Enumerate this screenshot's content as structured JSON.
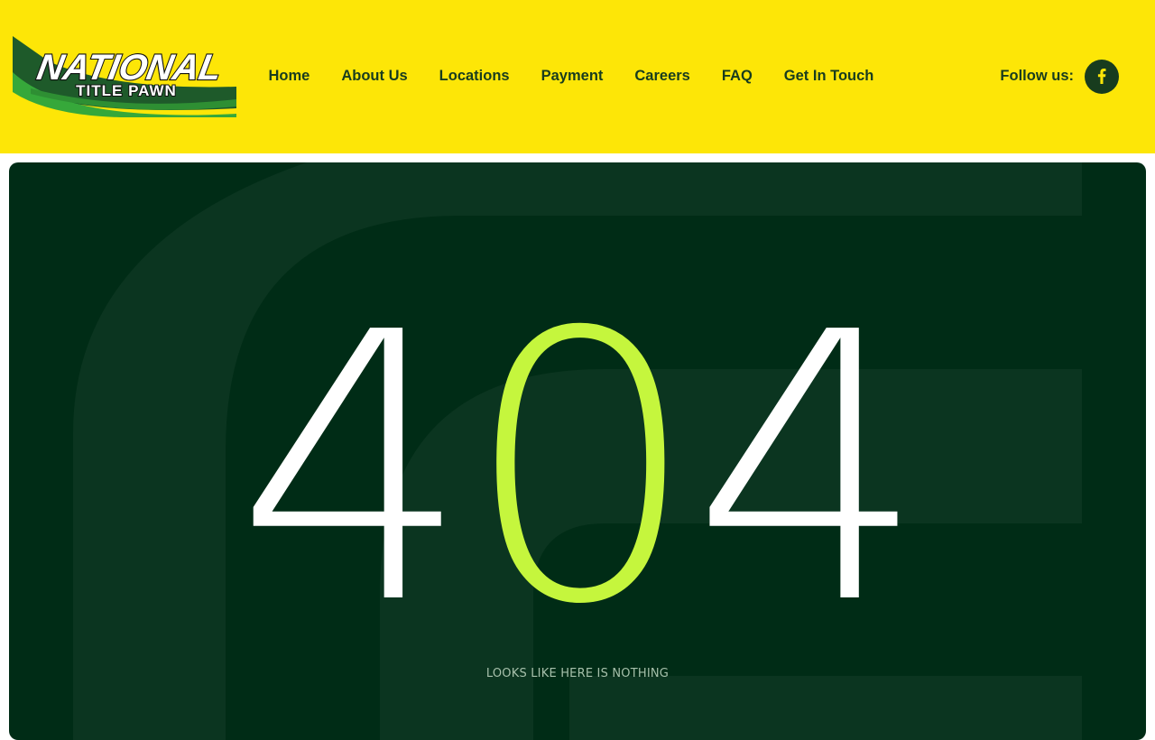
{
  "brand": {
    "logo_line1": "NATIONAL",
    "logo_line2": "TITLE PAWN"
  },
  "nav": {
    "items": [
      {
        "label": "Home"
      },
      {
        "label": "About Us"
      },
      {
        "label": "Locations"
      },
      {
        "label": "Payment"
      },
      {
        "label": "Careers"
      },
      {
        "label": "FAQ"
      },
      {
        "label": "Get In Touch"
      }
    ]
  },
  "social": {
    "label": "Follow us:",
    "facebook_icon": "facebook-icon"
  },
  "error": {
    "digit_1": "4",
    "digit_2": "0",
    "digit_3": "4",
    "message": "Looks like here is nothing"
  },
  "colors": {
    "header_bg": "#fde607",
    "nav_text": "#183c1e",
    "hero_bg": "#002c16",
    "accent": "#c5f63d"
  }
}
